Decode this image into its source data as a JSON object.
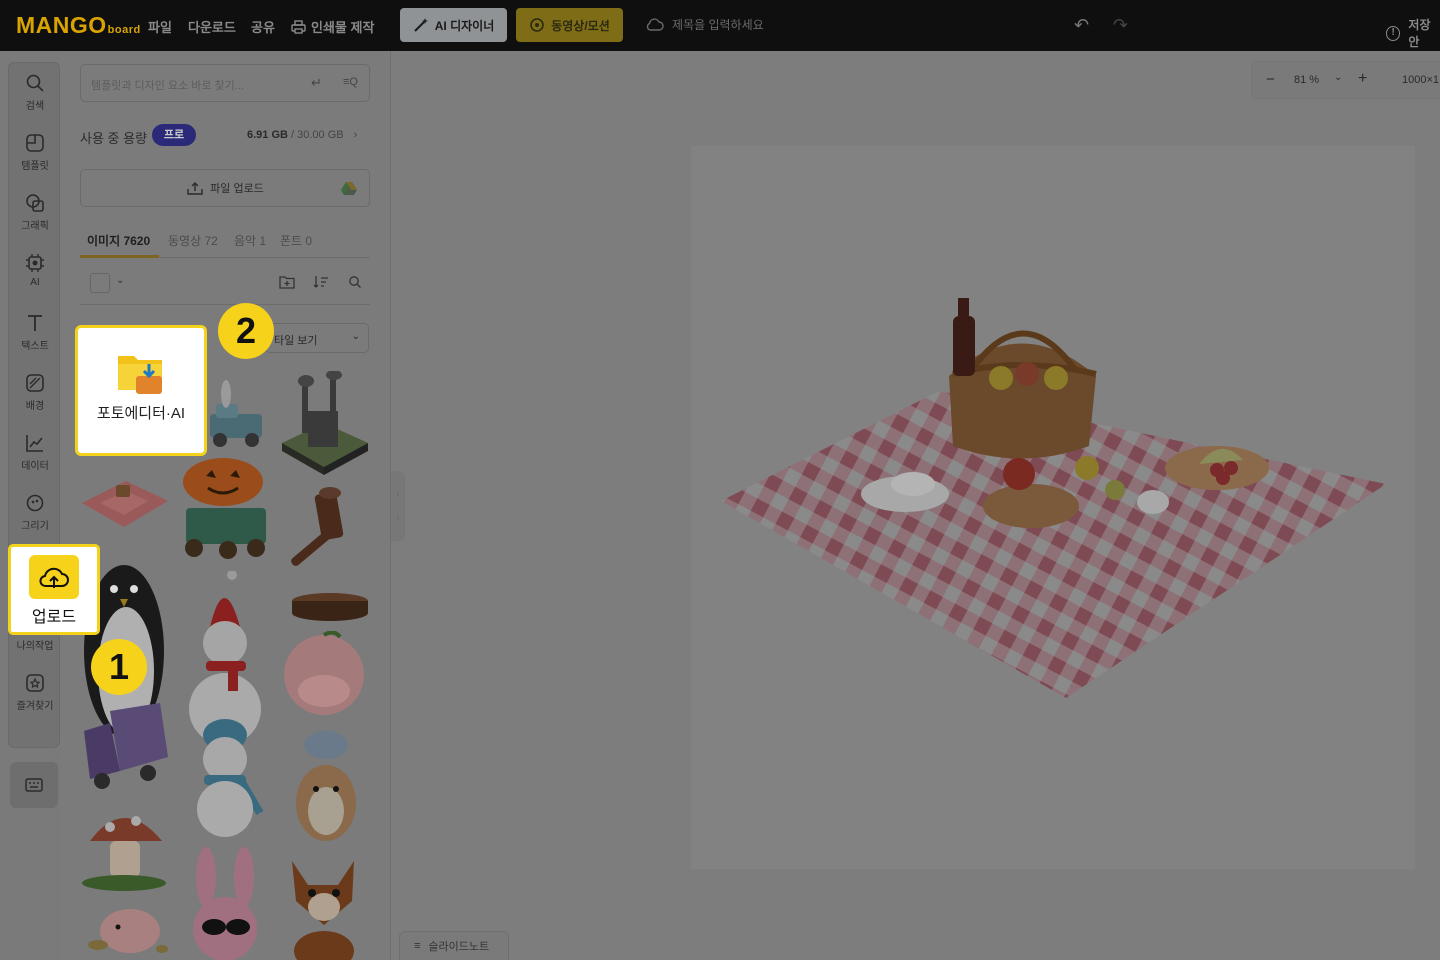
{
  "app": {
    "logo_main": "MANGO",
    "logo_sub": "board"
  },
  "topbar": {
    "menu": [
      "파일",
      "다운로드",
      "공유",
      "인쇄물 제작"
    ],
    "ai_designer": "AI 디자이너",
    "video_motion": "동영상/모션",
    "title_placeholder": "제목을 입력하세요",
    "save": "저장안"
  },
  "sidebar": {
    "items": [
      "검색",
      "템플릿",
      "그래픽",
      "AI",
      "텍스트",
      "배경",
      "데이터",
      "그리기",
      "업로드",
      "나의작업",
      "즐겨찾기"
    ]
  },
  "panel": {
    "search_placeholder": "템플릿과 디자인 요소 바로 찾기...",
    "usage_label": "사용 중 용량",
    "plan_badge": "프로",
    "usage_used": "6.91 GB",
    "usage_total": "/ 30.00 GB",
    "upload_button": "파일 업로드",
    "tabs": [
      "이미지 7620",
      "동영상 72",
      "음악 1",
      "폰트 0"
    ],
    "view_mode": "타일 보기"
  },
  "canvas": {
    "zoom": "81 %",
    "size_label": "1000×1",
    "slide_note": "슬라이드노트"
  },
  "highlights": {
    "upload_label": "업로드",
    "photo_editor_label": "포토에디터·AI",
    "step1": "1",
    "step2": "2"
  },
  "colors": {
    "accent_yellow": "#f6d21b",
    "pro_badge": "#2b2a78"
  }
}
